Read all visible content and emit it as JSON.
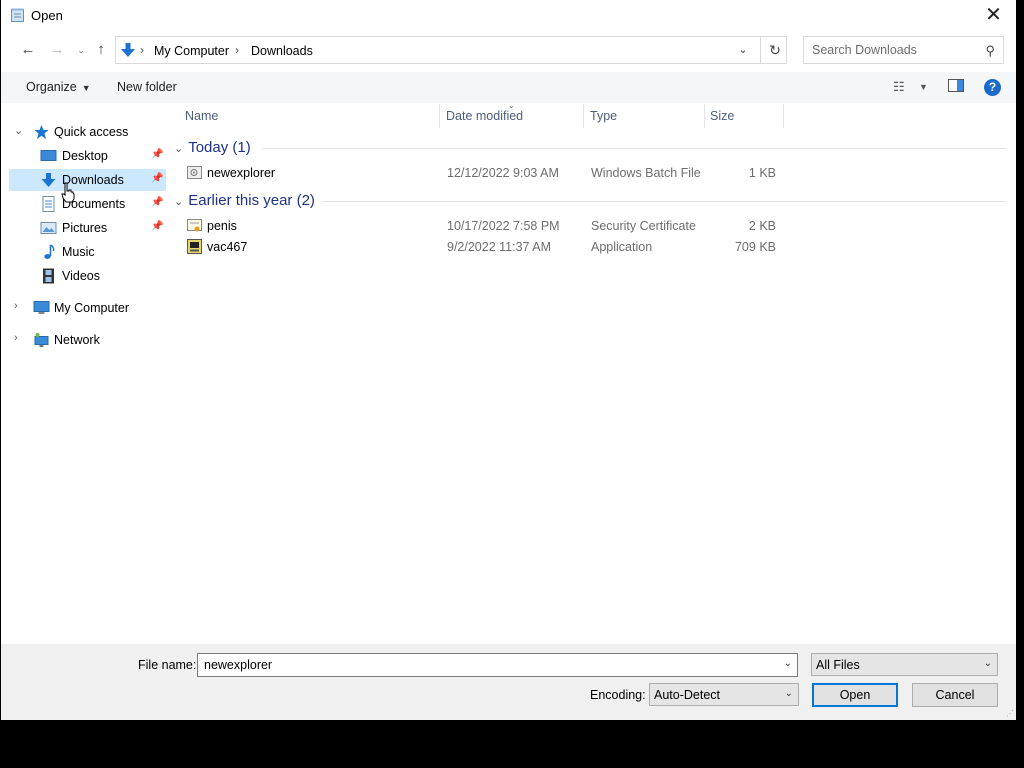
{
  "window": {
    "title": "Open",
    "close_glyph": "✕"
  },
  "address_bar": {
    "crumbs": [
      "My Computer",
      "Downloads"
    ],
    "search_placeholder": "Search Downloads"
  },
  "toolbar": {
    "organize_label": "Organize",
    "new_folder_label": "New folder"
  },
  "sidebar": {
    "items": [
      {
        "label": "Quick access",
        "icon": "star-icon"
      },
      {
        "label": "Desktop",
        "icon": "desktop-icon",
        "pinned": true
      },
      {
        "label": "Downloads",
        "icon": "download-arrow-icon",
        "pinned": true,
        "selected": true
      },
      {
        "label": "Documents",
        "icon": "documents-icon",
        "pinned": true
      },
      {
        "label": "Pictures",
        "icon": "pictures-icon",
        "pinned": true
      },
      {
        "label": "Music",
        "icon": "music-note-icon"
      },
      {
        "label": "Videos",
        "icon": "film-strip-icon"
      },
      {
        "label": "My Computer",
        "icon": "computer-icon"
      },
      {
        "label": "Network",
        "icon": "network-icon"
      }
    ]
  },
  "file_list": {
    "columns": [
      "Name",
      "Date modified",
      "Type",
      "Size"
    ],
    "groups": [
      {
        "title": "Today (1)",
        "files": [
          {
            "name": "newexplorer",
            "date": "12/12/2022 9:03 AM",
            "type": "Windows Batch File",
            "size": "1 KB",
            "icon": "batch-file-icon"
          }
        ]
      },
      {
        "title": "Earlier this year (2)",
        "files": [
          {
            "name": "penis",
            "date": "10/17/2022 7:58 PM",
            "type": "Security Certificate",
            "size": "2 KB",
            "icon": "certificate-icon"
          },
          {
            "name": "vac467",
            "date": "9/2/2022 11:37 AM",
            "type": "Application",
            "size": "709 KB",
            "icon": "application-icon"
          }
        ]
      }
    ]
  },
  "bottom": {
    "file_name_label": "File name:",
    "file_name_value": "newexplorer",
    "filter_value": "All Files",
    "encoding_label": "Encoding:",
    "encoding_value": "Auto-Detect",
    "open_label": "Open",
    "cancel_label": "Cancel"
  },
  "colors": {
    "accent": "#0078d7",
    "selected_bg": "#cce8ff",
    "group_header": "#1e3287"
  }
}
